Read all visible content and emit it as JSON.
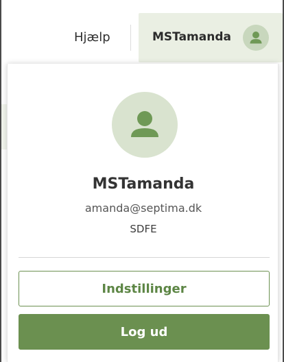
{
  "header": {
    "help_label": "Hjælp",
    "user_trigger_name": "MSTamanda"
  },
  "profile": {
    "name": "MSTamanda",
    "email": "amanda@septima.dk",
    "organization": "SDFE"
  },
  "menu": {
    "settings_label": "Indstillinger",
    "logout_label": "Log ud"
  },
  "colors": {
    "accent": "#6b9050",
    "avatar_bg": "#d9e3cf",
    "avatar_icon": "#6f9956",
    "trigger_bg": "#eaefe3"
  },
  "icons": {
    "trigger_avatar": "user-icon",
    "profile_avatar": "user-icon"
  }
}
